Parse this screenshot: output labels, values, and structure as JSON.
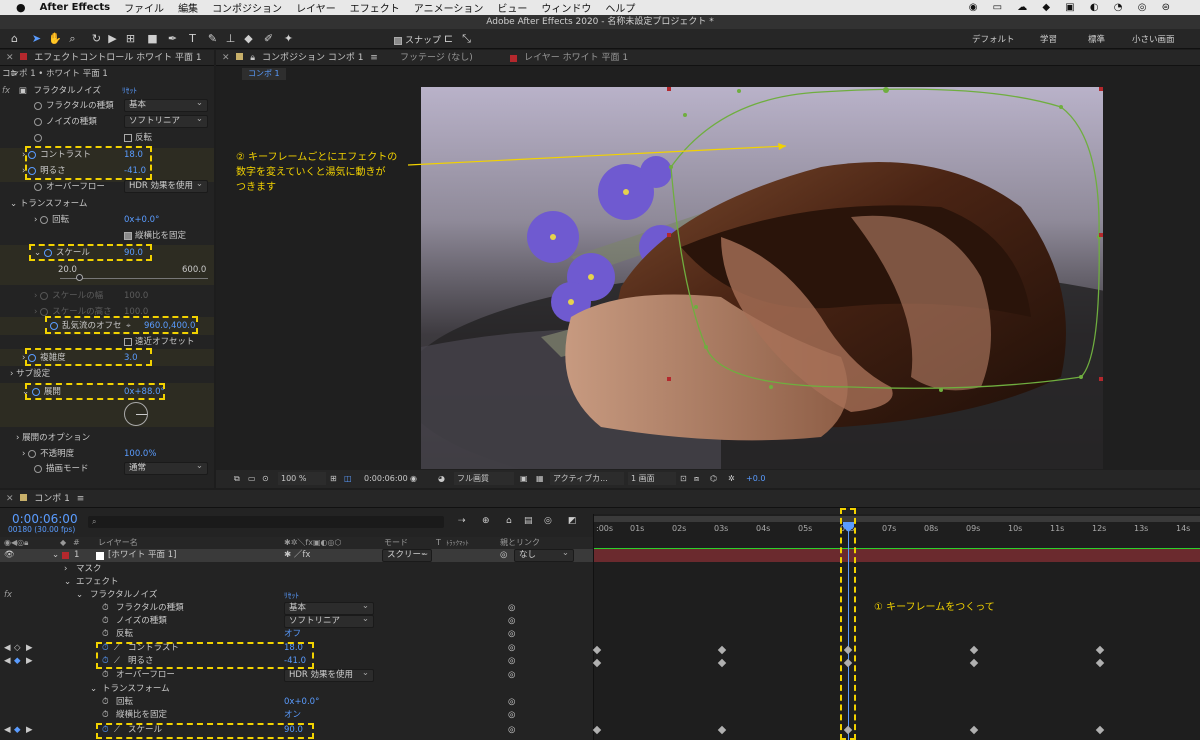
{
  "menubar": {
    "apple": "",
    "app": "After Effects",
    "items": [
      "ファイル",
      "編集",
      "コンポジション",
      "レイヤー",
      "エフェクト",
      "アニメーション",
      "ビュー",
      "ウィンドウ",
      "ヘルプ"
    ]
  },
  "window_title": "Adobe After Effects 2020 - 名称未設定プロジェクト *",
  "toolbar": {
    "snap_label": "スナップ",
    "workspaces": [
      "デフォルト",
      "学習",
      "標準",
      "小さい画面"
    ]
  },
  "effect_controls": {
    "tab": "エフェクトコントロール ホワイト 平面 1",
    "subtitle": "コンポ 1 • ホワイト 平面 1",
    "fx_name": "フラクタルノイズ",
    "reset": "ﾘｾｯﾄ",
    "props": {
      "fractal_type_label": "フラクタルの種類",
      "fractal_type": "基本",
      "noise_type_label": "ノイズの種類",
      "noise_type": "ソフトリニア",
      "invert_label": "反転",
      "contrast_label": "コントラスト",
      "contrast": "18.0",
      "brightness_label": "明るさ",
      "brightness": "-41.0",
      "overflow_label": "オーバーフロー",
      "overflow": "HDR 効果を使用",
      "transform_label": "トランスフォーム",
      "rotation_label": "回転",
      "rotation": "0x+0.0°",
      "uniform_label": "縦横比を固定",
      "scale_label": "スケール",
      "scale": "90.0",
      "scale_min": "20.0",
      "scale_max": "600.0",
      "scale_w_label": "スケールの幅",
      "scale_w": "100.0",
      "scale_h_label": "スケールの高さ",
      "scale_h": "100.0",
      "offset_label": "乱気流のオフセ",
      "offset": "960.0,400.0",
      "persp_label": "遠近オフセット",
      "complexity_label": "複雑度",
      "complexity": "3.0",
      "sub_label": "サブ設定",
      "evolution_label": "展開",
      "evolution": "0x+88.0°",
      "evo_options_label": "展開のオプション",
      "opacity_label": "不透明度",
      "opacity": "100.0%",
      "blend_label": "描画モード",
      "blend": "通常"
    }
  },
  "composition": {
    "tab": "コンポジション コンポ 1",
    "footage_tab": "フッテージ (なし)",
    "layer_tab": "レイヤー ホワイト 平面 1",
    "crumb": "コンポ 1",
    "annotation2": [
      "② キーフレームごとにエフェクトの",
      "数字を変えていくと湯気に動きが",
      "つきます"
    ],
    "footer": {
      "zoom": "100 %",
      "time": "0:00:06:00",
      "quality": "フル画質",
      "camera": "アクティブカ...",
      "views": "1 画面",
      "exposure": "+0.0"
    }
  },
  "timeline": {
    "tab": "コンポ 1",
    "timecode": "0:00:06:00",
    "fps": "00180 (30.00 fps)",
    "search_placeholder": "",
    "col_layer": "レイヤー名",
    "col_mode": "モード",
    "col_t": "T",
    "col_trkmat": "ﾄﾗｯｸﾏｯﾄ",
    "col_parent": "親とリンク",
    "ruler": [
      ":00s",
      "01s",
      "02s",
      "03s",
      "04s",
      "05s",
      "06s",
      "07s",
      "08s",
      "09s",
      "10s",
      "11s",
      "12s",
      "13s",
      "14s"
    ],
    "annotation1": "① キーフレームをつくって",
    "layer": {
      "num": "1",
      "name": "[ホワイト 平面 1]",
      "mode": "スクリー~",
      "parent": "なし"
    },
    "rows": {
      "mask": "マスク",
      "effect": "エフェクト",
      "fx": "フラクタルノイズ",
      "reset": "ﾘｾｯﾄ",
      "fractal_type_label": "フラクタルの種類",
      "fractal_type": "基本",
      "noise_type_label": "ノイズの種類",
      "noise_type": "ソフトリニア",
      "invert_label": "反転",
      "invert": "オフ",
      "contrast_label": "コントラスト",
      "contrast": "18.0",
      "brightness_label": "明るさ",
      "brightness": "-41.0",
      "overflow_label": "オーバーフロー",
      "overflow": "HDR 効果を使用",
      "transform_label": "トランスフォーム",
      "rotation_label": "回転",
      "rotation": "0x+0.0°",
      "uniform_label": "縦横比を固定",
      "uniform": "オン",
      "scale_label": "スケール",
      "scale": "90.0"
    }
  },
  "colors": {
    "accent": "#5a9cff",
    "highlight": "#f2d200",
    "path": "#6fae3f"
  }
}
